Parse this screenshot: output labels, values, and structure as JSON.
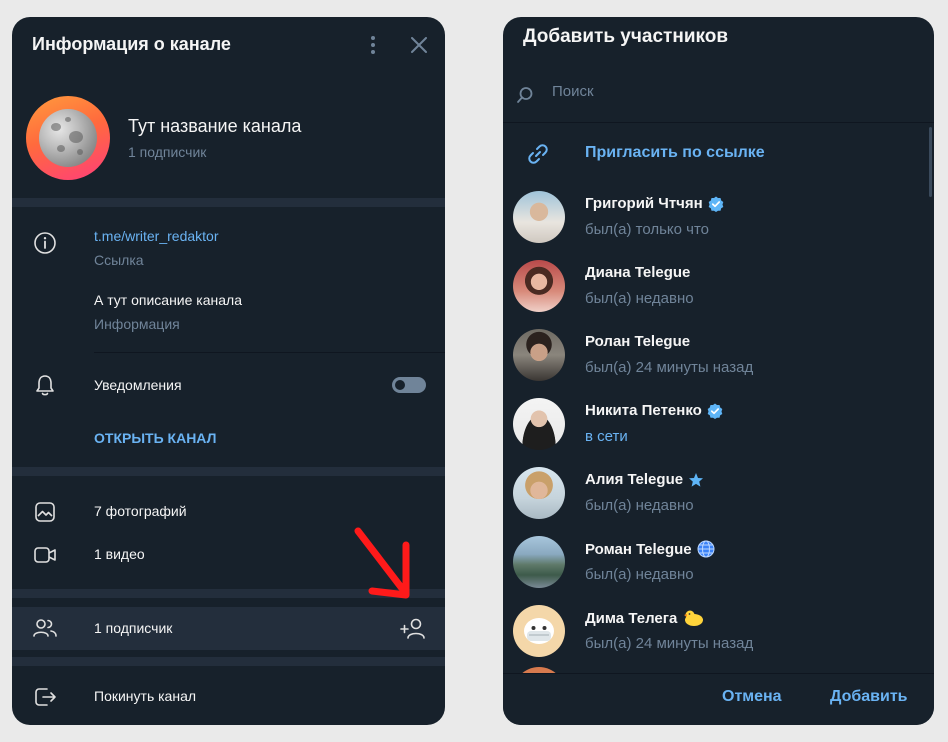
{
  "left_panel": {
    "title": "Информация о канале",
    "channel_name": "Тут название канала",
    "subscribers_count": "1 подписчик",
    "link_value": "t.me/writer_redaktor",
    "link_caption": "Ссылка",
    "description": "А тут описание канала",
    "description_caption": "Информация",
    "notifications_label": "Уведомления",
    "notifications_enabled": false,
    "open_channel_label": "ОТКРЫТЬ КАНАЛ",
    "photos_label": "7 фотографий",
    "videos_label": "1 видео",
    "members_label": "1 подписчик",
    "leave_label": "Покинуть канал"
  },
  "right_panel": {
    "title": "Добавить участников",
    "search_placeholder": "Поиск",
    "invite_link_label": "Пригласить по ссылке",
    "contacts": [
      {
        "name": "Григорий Чтчян",
        "status": "был(а) только что",
        "badge": "verified-icon",
        "online": false
      },
      {
        "name": "Диана Telegue",
        "status": "был(а) недавно",
        "badge": "",
        "online": false
      },
      {
        "name": "Ролан Telegue",
        "status": "был(а) 24 минуты назад",
        "badge": "",
        "online": false
      },
      {
        "name": "Никита Петенко",
        "status": "в сети",
        "badge": "verified-icon",
        "online": true
      },
      {
        "name": "Алия Telegue",
        "status": "был(а) недавно",
        "badge": "star-icon",
        "online": false
      },
      {
        "name": "Роман Telegue",
        "status": "был(а) недавно",
        "badge": "globe-icon",
        "online": false
      },
      {
        "name": "Дима Телега",
        "status": "был(а) 24 минуты назад",
        "badge": "duck-emoji-icon",
        "online": false
      }
    ],
    "cancel_label": "Отмена",
    "add_label": "Добавить"
  },
  "colors": {
    "panel_bg": "#17212b",
    "separator": "#232e3c",
    "accent": "#6ab3f3",
    "secondary_text": "#708499",
    "annotation_arrow": "#ff1a1a"
  }
}
